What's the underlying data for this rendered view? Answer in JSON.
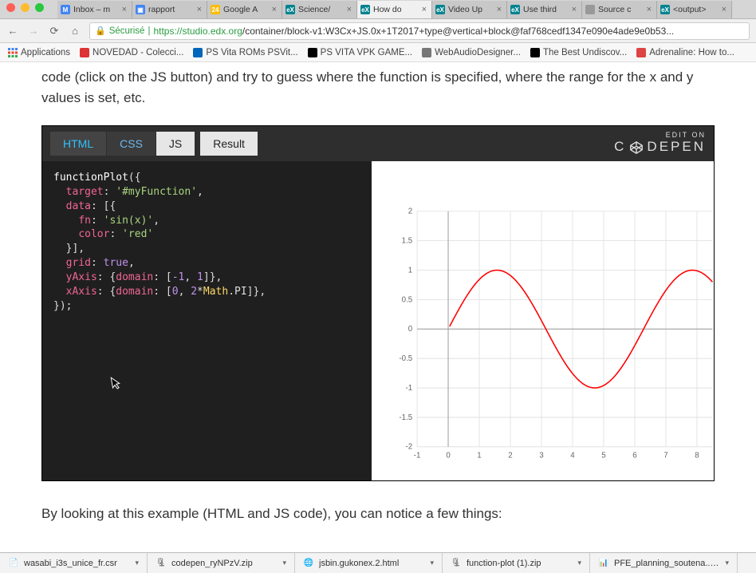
{
  "mac": {
    "colors": [
      "#ff5f57",
      "#febc2e",
      "#28c840"
    ]
  },
  "tabs": [
    {
      "fav_bg": "#4285f4",
      "fav_txt": "M",
      "label": "Inbox – m"
    },
    {
      "fav_bg": "#4285f4",
      "fav_txt": "▣",
      "label": "rapport"
    },
    {
      "fav_bg": "#fbbc05",
      "fav_txt": "24",
      "label": "Google A"
    },
    {
      "fav_bg": "#00838f",
      "fav_txt": "eX",
      "label": "Science/"
    },
    {
      "fav_bg": "#00838f",
      "fav_txt": "eX",
      "label": "How do",
      "active": true
    },
    {
      "fav_bg": "#00838f",
      "fav_txt": "eX",
      "label": "Video Up"
    },
    {
      "fav_bg": "#00838f",
      "fav_txt": "eX",
      "label": "Use third"
    },
    {
      "fav_bg": "#999",
      "fav_txt": "",
      "label": "Source c"
    },
    {
      "fav_bg": "#00838f",
      "fav_txt": "eX",
      "label": "<output>"
    }
  ],
  "address": {
    "secure_label": "Sécurisé",
    "url_prefix": "https://",
    "url_host": "studio.edx.org",
    "url_rest": "/container/block-v1:W3Cx+JS.0x+1T2017+type@vertical+block@faf768cedf1347e090e4ade9e0b53..."
  },
  "bookmarks": [
    {
      "bg": "#4285f4",
      "label": "Applications",
      "apps": true
    },
    {
      "bg": "#d33",
      "label": "NOVEDAD - Colecci..."
    },
    {
      "bg": "#06b",
      "label": "PS Vita ROMs PSVit..."
    },
    {
      "bg": "#000",
      "label": "PS VITA VPK GAME..."
    },
    {
      "bg": "#777",
      "label": "WebAudioDesigner..."
    },
    {
      "bg": "#000",
      "label": "The Best Undiscov..."
    },
    {
      "bg": "#d44",
      "label": "Adrenaline: How to..."
    }
  ],
  "page_text_top": "code (click on the JS button) and try to guess where the function is specified, where the range for the x and y values is set, etc.",
  "page_text_bottom": "By looking at this example (HTML and JS code), you can notice a few things:",
  "codepen": {
    "tabs": {
      "html": "HTML",
      "css": "CSS",
      "js": "JS",
      "result": "Result"
    },
    "editon": "EDIT ON",
    "brand_a": "C",
    "brand_b": "DEPEN"
  },
  "code": {
    "l1a": "functionPlot",
    "l1b": "({",
    "l2k": "target",
    "l2v": "'#myFunction'",
    "l2p": ",",
    "l3k": "data",
    "l3p": ": [{",
    "l4k": "fn",
    "l4v": "'sin(x)'",
    "l4p": ",",
    "l5k": "color",
    "l5v": "'red'",
    "l6": "}],",
    "l7k": "grid",
    "l7v": "true",
    "l7p": ",",
    "l8k": "yAxis",
    "l8a": ": {",
    "l8k2": "domain",
    "l8b": ": [",
    "l8n1": "-1",
    "l8c": ", ",
    "l8n2": "1",
    "l8d": "]},",
    "l9k": "xAxis",
    "l9a": ": {",
    "l9k2": "domain",
    "l9b": ": [",
    "l9n1": "0",
    "l9c": ", ",
    "l9n2": "2",
    "l9star": "*",
    "l9cls": "Math",
    "l9pi": ".PI]},",
    "l10": "});"
  },
  "chart_data": {
    "type": "line",
    "title": "",
    "xlabel": "",
    "ylabel": "",
    "function": "sin(x)",
    "color": "red",
    "grid": true,
    "xlim": [
      -1,
      8.5
    ],
    "ylim": [
      -2,
      2
    ],
    "xticks": [
      -1,
      0,
      1,
      2,
      3,
      4,
      5,
      6,
      7,
      8
    ],
    "yticks": [
      -2,
      -1.5,
      -1,
      -0.5,
      0,
      0.5,
      1,
      1.5,
      2
    ],
    "series": [
      {
        "name": "sin(x)",
        "color": "red",
        "x": [
          0,
          0.5,
          1,
          1.5,
          2,
          2.5,
          3,
          3.5,
          4,
          4.5,
          5,
          5.5,
          6,
          6.283,
          6.5,
          7,
          7.5,
          8,
          8.5
        ],
        "y": [
          0,
          0.479,
          0.841,
          0.997,
          0.909,
          0.599,
          0.141,
          -0.351,
          -0.757,
          -0.978,
          -0.959,
          -0.706,
          -0.279,
          0,
          0.215,
          0.657,
          0.938,
          0.989,
          0.798
        ]
      }
    ]
  },
  "downloads": [
    {
      "icon": "📄",
      "label": "wasabi_i3s_unice_fr.csr",
      "color": ""
    },
    {
      "icon": "🗜",
      "label": "codepen_ryNPzV.zip",
      "color": "#555"
    },
    {
      "icon": "🌐",
      "label": "jsbin.gukonex.2.html",
      "color": "#e44d26"
    },
    {
      "icon": "🗜",
      "label": "function-plot (1).zip",
      "color": "#555"
    },
    {
      "icon": "📊",
      "label": "PFE_planning_soutena....xlsx",
      "color": "#217346"
    }
  ]
}
